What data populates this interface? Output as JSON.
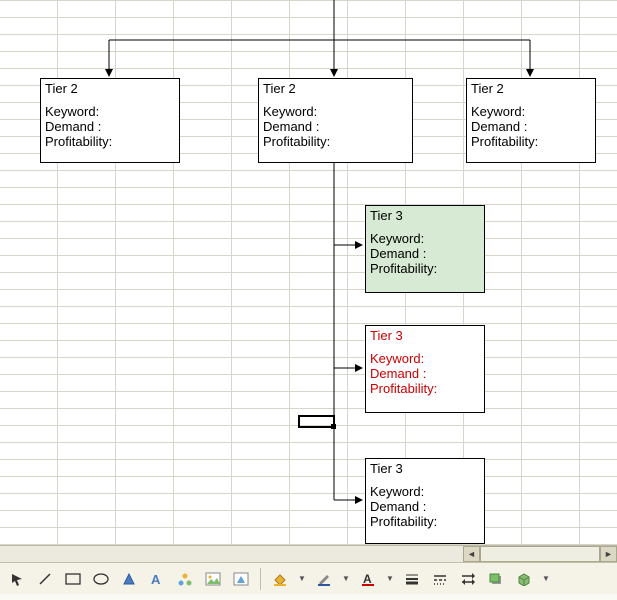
{
  "tier2_boxes": [
    {
      "title": "Tier 2",
      "keyword_label": "Keyword:",
      "demand_label": "Demand :",
      "profit_label": "Profitability:"
    },
    {
      "title": "Tier 2",
      "keyword_label": "Keyword:",
      "demand_label": "Demand :",
      "profit_label": "Profitability:"
    },
    {
      "title": "Tier 2",
      "keyword_label": "Keyword:",
      "demand_label": "Demand :",
      "profit_label": "Profitability:"
    }
  ],
  "tier3_boxes": [
    {
      "title": "Tier 3",
      "keyword_label": "Keyword:",
      "demand_label": "Demand :",
      "profit_label": "Profitability:",
      "style": "green"
    },
    {
      "title": "Tier 3",
      "keyword_label": "Keyword:",
      "demand_label": "Demand :",
      "profit_label": "Profitability:",
      "style": "red"
    },
    {
      "title": "Tier 3",
      "keyword_label": "Keyword:",
      "demand_label": "Demand :",
      "profit_label": "Profitability:",
      "style": "plain"
    }
  ],
  "toolbar": {
    "arrow": "arrow-cursor",
    "line": "line-tool",
    "rect": "rectangle-tool",
    "oval": "oval-tool",
    "autoshapes": "autoshapes",
    "wordart": "wordart",
    "diagram": "diagram",
    "image": "insert-image",
    "clipart": "clipart",
    "fill": "fill-color",
    "linecolor": "line-color",
    "fontcolor": "font-color",
    "lineweight": "line-weight",
    "dash": "dash-style",
    "arrowstyle": "arrow-style",
    "shadow": "shadow",
    "threeD": "3d-style"
  }
}
